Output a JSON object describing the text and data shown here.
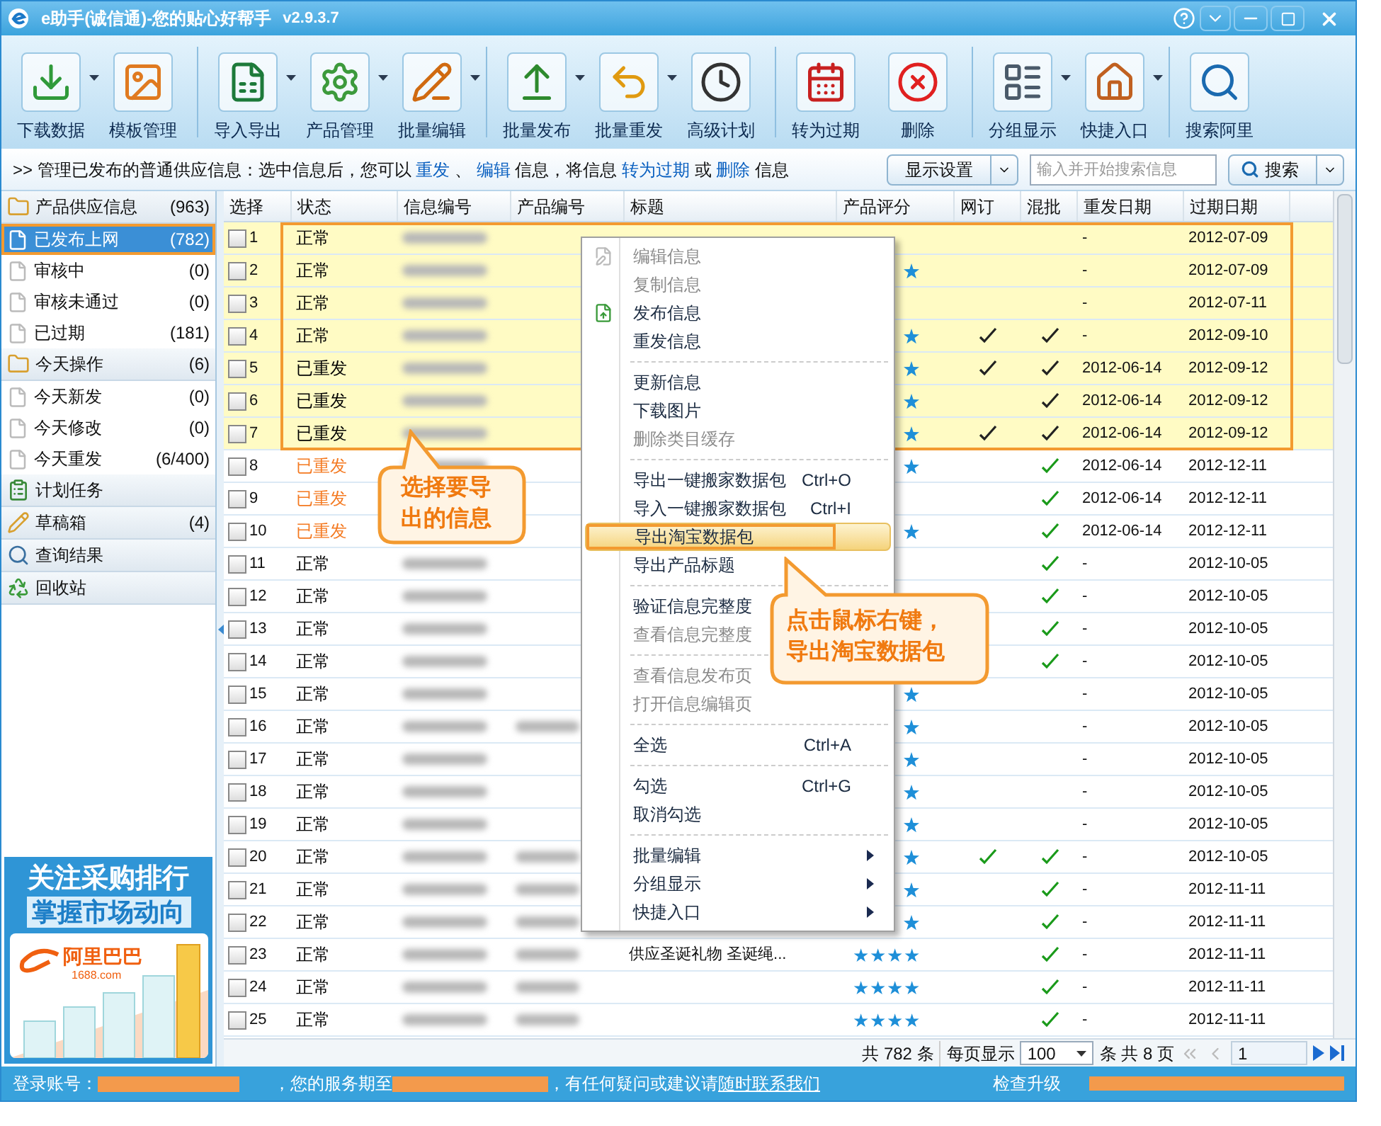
{
  "window": {
    "title": "e助手(诚信通)-您的贴心好帮手",
    "version": "v2.9.3.7"
  },
  "toolbar": [
    {
      "label": "下载数据",
      "dropdown": true
    },
    {
      "label": "模板管理",
      "dropdown": false
    },
    {
      "label": "导入导出",
      "dropdown": true
    },
    {
      "label": "产品管理",
      "dropdown": true
    },
    {
      "label": "批量编辑",
      "dropdown": true
    },
    {
      "label": "批量发布",
      "dropdown": true
    },
    {
      "label": "批量重发",
      "dropdown": true
    },
    {
      "label": "高级计划",
      "dropdown": false
    },
    {
      "label": "转为过期",
      "dropdown": false
    },
    {
      "label": "删除",
      "dropdown": false
    },
    {
      "label": "分组显示",
      "dropdown": true
    },
    {
      "label": "快捷入口",
      "dropdown": true
    },
    {
      "label": "搜索阿里",
      "dropdown": false
    }
  ],
  "info_bar": {
    "segments": [
      {
        "kind": "text",
        "text": ">> 管理已发布的普通供应信息：选中信息后，您可以 "
      },
      {
        "kind": "link",
        "text": "重发"
      },
      {
        "kind": "text",
        "text": " 、 "
      },
      {
        "kind": "link",
        "text": "编辑"
      },
      {
        "kind": "text",
        "text": " 信息，将信息 "
      },
      {
        "kind": "link",
        "text": "转为过期"
      },
      {
        "kind": "text",
        "text": " 或 "
      },
      {
        "kind": "link",
        "text": "删除"
      },
      {
        "kind": "text",
        "text": " 信息"
      }
    ],
    "display_button": "显示设置",
    "search": {
      "placeholder": "输入并开始搜索信息"
    },
    "search_button": "搜索"
  },
  "sidebar": {
    "groups": [
      {
        "label": "产品供应信息",
        "count": "(963)",
        "children": [
          {
            "label": "已发布上网",
            "count": "(782)",
            "selected": true
          },
          {
            "label": "审核中",
            "count": "(0)",
            "selected": false
          },
          {
            "label": "审核未通过",
            "count": "(0)",
            "selected": false
          },
          {
            "label": "已过期",
            "count": "(181)",
            "selected": false
          }
        ]
      },
      {
        "label": "今天操作",
        "count": "(6)",
        "children": [
          {
            "label": "今天新发",
            "count": "(0)",
            "selected": false
          },
          {
            "label": "今天修改",
            "count": "(0)",
            "selected": false
          },
          {
            "label": "今天重发",
            "count": "(6/400)",
            "selected": false
          }
        ]
      },
      {
        "label": "计划任务"
      },
      {
        "label": "草稿箱",
        "count": "(4)"
      },
      {
        "label": "查询结果"
      },
      {
        "label": "回收站"
      }
    ],
    "ad": {
      "headline": "关注采购排行",
      "subline": "掌握市场动向",
      "brand": "阿里巴巴",
      "domain": "1688.com"
    }
  },
  "table": {
    "columns": [
      "选择",
      "状态",
      "信息编号",
      "产品编号",
      "标题",
      "产品评分",
      "网订",
      "混批",
      "重发日期",
      "过期日期"
    ],
    "rows": [
      {
        "no": "1",
        "checked": false,
        "selected": true,
        "status": "正常",
        "color": "#000000",
        "product_no": false,
        "rating_peek": false,
        "web_order": false,
        "mixed": false,
        "resend_date": "-",
        "expire_date": "2012-07-09"
      },
      {
        "no": "2",
        "checked": false,
        "selected": true,
        "status": "正常",
        "color": "#000000",
        "product_no": false,
        "rating_peek": true,
        "web_order": false,
        "mixed": false,
        "resend_date": "-",
        "expire_date": "2012-07-09"
      },
      {
        "no": "3",
        "checked": false,
        "selected": true,
        "status": "正常",
        "color": "#000000",
        "product_no": false,
        "rating_peek": false,
        "web_order": false,
        "mixed": false,
        "resend_date": "-",
        "expire_date": "2012-07-11"
      },
      {
        "no": "4",
        "checked": false,
        "selected": true,
        "status": "正常",
        "color": "#000000",
        "product_no": false,
        "rating_peek": true,
        "web_order": true,
        "mixed": true,
        "resend_date": "-",
        "expire_date": "2012-09-10"
      },
      {
        "no": "5",
        "checked": false,
        "selected": true,
        "status": "已重发",
        "color": "#000000",
        "product_no": false,
        "rating_peek": true,
        "web_order": true,
        "mixed": true,
        "resend_date": "2012-06-14",
        "expire_date": "2012-09-12"
      },
      {
        "no": "6",
        "checked": false,
        "selected": true,
        "status": "已重发",
        "color": "#000000",
        "product_no": false,
        "rating_peek": true,
        "web_order": false,
        "mixed": true,
        "resend_date": "2012-06-14",
        "expire_date": "2012-09-12"
      },
      {
        "no": "7",
        "checked": false,
        "selected": true,
        "status": "已重发",
        "color": "#000000",
        "product_no": false,
        "rating_peek": true,
        "web_order": true,
        "mixed": true,
        "resend_date": "2012-06-14",
        "expire_date": "2012-09-12"
      },
      {
        "no": "8",
        "checked": false,
        "selected": false,
        "status": "已重发",
        "color": "#f47920",
        "product_no": false,
        "rating_peek": true,
        "web_order": false,
        "mixed": true,
        "resend_date": "2012-06-14",
        "expire_date": "2012-12-11"
      },
      {
        "no": "9",
        "checked": false,
        "selected": false,
        "status": "已重发",
        "color": "#f47920",
        "info_no": false,
        "product_no": false,
        "rating_peek": false,
        "web_order": false,
        "mixed": true,
        "resend_date": "2012-06-14",
        "expire_date": "2012-12-11"
      },
      {
        "no": "10",
        "checked": false,
        "selected": false,
        "status": "已重发",
        "color": "#f47920",
        "info_no": false,
        "product_no": false,
        "rating_peek": true,
        "web_order": false,
        "mixed": true,
        "resend_date": "2012-06-14",
        "expire_date": "2012-12-11"
      },
      {
        "no": "11",
        "checked": false,
        "selected": false,
        "status": "正常",
        "color": "#000000",
        "product_no": false,
        "rating_peek": false,
        "web_order": false,
        "mixed": true,
        "resend_date": "-",
        "expire_date": "2012-10-05"
      },
      {
        "no": "12",
        "checked": false,
        "selected": false,
        "status": "正常",
        "color": "#000000",
        "product_no": false,
        "rating_peek": false,
        "web_order": false,
        "mixed": true,
        "resend_date": "-",
        "expire_date": "2012-10-05"
      },
      {
        "no": "13",
        "checked": false,
        "selected": false,
        "status": "正常",
        "color": "#000000",
        "product_no": false,
        "rating_peek": false,
        "web_order": false,
        "mixed": true,
        "resend_date": "-",
        "expire_date": "2012-10-05"
      },
      {
        "no": "14",
        "checked": false,
        "selected": false,
        "status": "正常",
        "color": "#000000",
        "product_no": false,
        "rating_peek": false,
        "web_order": false,
        "mixed": true,
        "resend_date": "-",
        "expire_date": "2012-10-05"
      },
      {
        "no": "15",
        "checked": false,
        "selected": false,
        "status": "正常",
        "color": "#000000",
        "product_no": false,
        "rating_peek": true,
        "web_order": false,
        "mixed": false,
        "resend_date": "-",
        "expire_date": "2012-10-05"
      },
      {
        "no": "16",
        "checked": false,
        "selected": false,
        "status": "正常",
        "color": "#000000",
        "product_no": true,
        "rating_peek": true,
        "web_order": false,
        "mixed": false,
        "resend_date": "-",
        "expire_date": "2012-10-05"
      },
      {
        "no": "17",
        "checked": false,
        "selected": false,
        "status": "正常",
        "color": "#000000",
        "product_no": false,
        "rating_peek": true,
        "web_order": false,
        "mixed": false,
        "resend_date": "-",
        "expire_date": "2012-10-05"
      },
      {
        "no": "18",
        "checked": false,
        "selected": false,
        "status": "正常",
        "color": "#000000",
        "product_no": false,
        "rating_peek": true,
        "web_order": false,
        "mixed": false,
        "resend_date": "-",
        "expire_date": "2012-10-05"
      },
      {
        "no": "19",
        "checked": false,
        "selected": false,
        "status": "正常",
        "color": "#000000",
        "product_no": false,
        "rating_peek": true,
        "web_order": false,
        "mixed": false,
        "resend_date": "-",
        "expire_date": "2012-10-05"
      },
      {
        "no": "20",
        "checked": false,
        "selected": false,
        "status": "正常",
        "color": "#000000",
        "product_no": true,
        "rating_peek": true,
        "web_order": true,
        "mixed": true,
        "resend_date": "-",
        "expire_date": "2012-10-05"
      },
      {
        "no": "21",
        "checked": false,
        "selected": false,
        "status": "正常",
        "color": "#000000",
        "product_no": true,
        "rating_peek": true,
        "web_order": false,
        "mixed": true,
        "resend_date": "-",
        "expire_date": "2012-11-11"
      },
      {
        "no": "22",
        "checked": false,
        "selected": false,
        "status": "正常",
        "color": "#000000",
        "product_no": true,
        "rating_peek": true,
        "web_order": false,
        "mixed": true,
        "resend_date": "-",
        "expire_date": "2012-11-11"
      },
      {
        "no": "23",
        "checked": false,
        "selected": false,
        "status": "正常",
        "color": "#000000",
        "product_no": true,
        "title": "供应圣诞礼物 圣诞绳...",
        "stars": 4,
        "web_order": false,
        "mixed": true,
        "resend_date": "-",
        "expire_date": "2012-11-11"
      },
      {
        "no": "24",
        "checked": false,
        "selected": false,
        "status": "正常",
        "color": "#000000",
        "product_no": true,
        "stars": 4,
        "web_order": false,
        "mixed": true,
        "resend_date": "-",
        "expire_date": "2012-11-11"
      },
      {
        "no": "25",
        "checked": false,
        "selected": false,
        "status": "正常",
        "color": "#000000",
        "product_no": true,
        "stars": 4,
        "web_order": false,
        "mixed": true,
        "resend_date": "-",
        "expire_date": "2012-11-11"
      }
    ]
  },
  "pagination": {
    "total": "共 782 条",
    "per_page_label": "每页显示",
    "per_page": "100",
    "pages": "条 共 8 页",
    "page": "1"
  },
  "context_menu": [
    {
      "kind": "item",
      "label": "编辑信息",
      "disabled": true,
      "selected": false
    },
    {
      "kind": "item",
      "label": "复制信息",
      "disabled": true,
      "selected": false
    },
    {
      "kind": "item",
      "label": "发布信息",
      "disabled": false,
      "selected": false
    },
    {
      "kind": "item",
      "label": "重发信息",
      "disabled": false,
      "selected": false
    },
    {
      "kind": "separator"
    },
    {
      "kind": "item",
      "label": "更新信息",
      "disabled": false,
      "selected": false
    },
    {
      "kind": "item",
      "label": "下载图片",
      "disabled": false,
      "selected": false
    },
    {
      "kind": "item",
      "label": "删除类目缓存",
      "disabled": true,
      "selected": false
    },
    {
      "kind": "separator"
    },
    {
      "kind": "item",
      "label": "导出一键搬家数据包",
      "shortcut": "Ctrl+O",
      "disabled": false,
      "selected": false
    },
    {
      "kind": "item",
      "label": "导入一键搬家数据包",
      "shortcut": "Ctrl+I",
      "disabled": false,
      "selected": false
    },
    {
      "kind": "item",
      "label": "导出淘宝数据包",
      "disabled": false,
      "selected": true
    },
    {
      "kind": "item",
      "label": "导出产品标题",
      "disabled": false,
      "selected": false
    },
    {
      "kind": "separator"
    },
    {
      "kind": "item",
      "label": "验证信息完整度",
      "disabled": false,
      "selected": false
    },
    {
      "kind": "item",
      "label": "查看信息完整度",
      "disabled": true,
      "selected": false
    },
    {
      "kind": "separator"
    },
    {
      "kind": "item",
      "label": "查看信息发布页",
      "disabled": true,
      "selected": false
    },
    {
      "kind": "item",
      "label": "打开信息编辑页",
      "disabled": true,
      "selected": false
    },
    {
      "kind": "separator"
    },
    {
      "kind": "item",
      "label": "全选",
      "shortcut": "Ctrl+A",
      "disabled": false,
      "selected": false
    },
    {
      "kind": "separator"
    },
    {
      "kind": "item",
      "label": "勾选",
      "shortcut": "Ctrl+G",
      "disabled": false,
      "selected": false
    },
    {
      "kind": "item",
      "label": "取消勾选",
      "disabled": false,
      "selected": false
    },
    {
      "kind": "separator"
    },
    {
      "kind": "item",
      "label": "批量编辑",
      "submenu": true,
      "disabled": false,
      "selected": false
    },
    {
      "kind": "item",
      "label": "分组显示",
      "submenu": true,
      "disabled": false,
      "selected": false
    },
    {
      "kind": "item",
      "label": "快捷入口",
      "submenu": true,
      "disabled": false,
      "selected": false
    }
  ],
  "annotations": [
    {
      "lines": [
        "选择要导",
        "出的信息"
      ]
    },
    {
      "lines": [
        "点击鼠标右键，",
        "导出淘宝数据包"
      ]
    }
  ],
  "status_bar": {
    "login_label": "登录账号：",
    "service": "，您的服务期至",
    "contact": "，有任何疑问或建议请",
    "contact_link": "随时联系我们",
    "upgrade": "检查升级"
  }
}
